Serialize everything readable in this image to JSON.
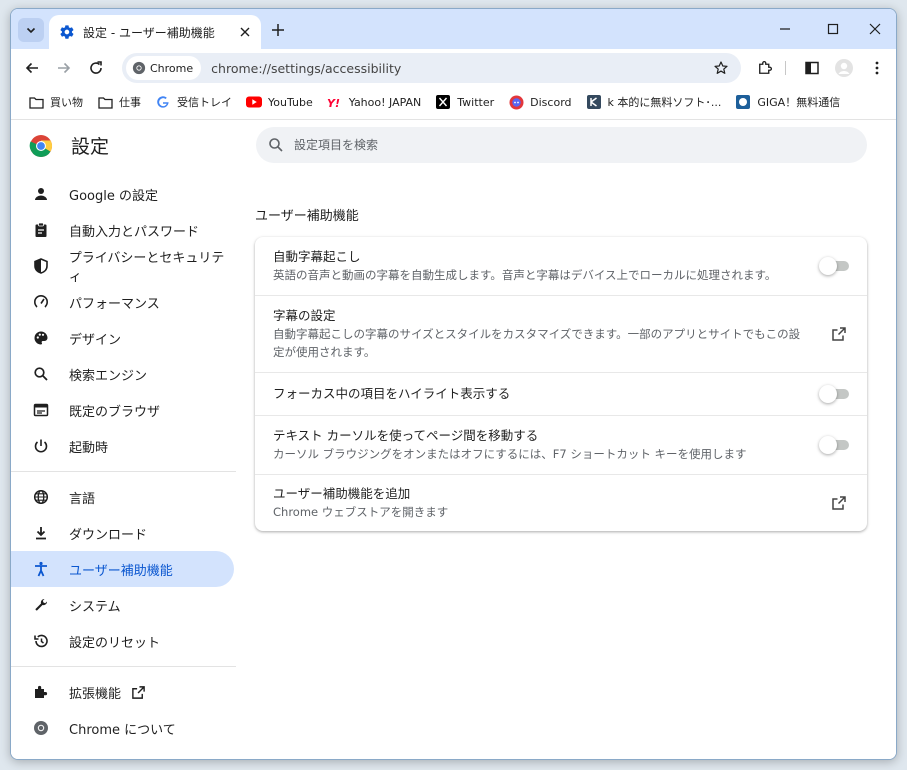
{
  "tab": {
    "title": "設定 - ユーザー補助機能"
  },
  "toolbar": {
    "chip_label": "Chrome",
    "url": "chrome://settings/accessibility"
  },
  "bookmarks": [
    {
      "label": "買い物",
      "icon": "folder-icon"
    },
    {
      "label": "仕事",
      "icon": "folder-icon"
    },
    {
      "label": "受信トレイ",
      "icon": "google-icon"
    },
    {
      "label": "YouTube",
      "icon": "youtube-icon"
    },
    {
      "label": "Yahoo! JAPAN",
      "icon": "yahoo-icon"
    },
    {
      "label": "Twitter",
      "icon": "x-icon"
    },
    {
      "label": "Discord",
      "icon": "discord-icon"
    },
    {
      "label": "k 本的に無料ソフト･...",
      "icon": "site-icon"
    },
    {
      "label": "GIGA！無料通信",
      "icon": "giga-icon"
    }
  ],
  "settings": {
    "title": "設定",
    "search_placeholder": "設定項目を検索",
    "nav": [
      {
        "label": "Google の設定",
        "icon": "person-icon"
      },
      {
        "label": "自動入力とパスワード",
        "icon": "clipboard-icon"
      },
      {
        "label": "プライバシーとセキュリティ",
        "icon": "shield-icon"
      },
      {
        "label": "パフォーマンス",
        "icon": "gauge-icon"
      },
      {
        "label": "デザイン",
        "icon": "palette-icon"
      },
      {
        "label": "検索エンジン",
        "icon": "search-icon"
      },
      {
        "label": "既定のブラウザ",
        "icon": "browser-icon"
      },
      {
        "label": "起動時",
        "icon": "power-icon"
      },
      {
        "label": "言語",
        "icon": "globe-icon"
      },
      {
        "label": "ダウンロード",
        "icon": "download-icon"
      },
      {
        "label": "ユーザー補助機能",
        "icon": "accessibility-icon"
      },
      {
        "label": "システム",
        "icon": "wrench-icon"
      },
      {
        "label": "設定のリセット",
        "icon": "reset-icon"
      },
      {
        "label": "拡張機能",
        "icon": "puzzle-icon"
      },
      {
        "label": "Chrome について",
        "icon": "chrome-icon"
      }
    ],
    "section_title": "ユーザー補助機能",
    "rows": [
      {
        "title": "自動字幕起こし",
        "sub": "英語の音声と動画の字幕を自動生成します。音声と字幕はデバイス上でローカルに処理されます。",
        "control": "toggle",
        "on": false
      },
      {
        "title": "字幕の設定",
        "sub": "自動字幕起こしの字幕のサイズとスタイルをカスタマイズできます。一部のアプリとサイトでもこの設定が使用されます。",
        "control": "external"
      },
      {
        "title": "フォーカス中の項目をハイライト表示する",
        "sub": "",
        "control": "toggle",
        "on": false
      },
      {
        "title": "テキスト カーソルを使ってページ間を移動する",
        "sub": "カーソル ブラウジングをオンまたはオフにするには、F7 ショートカット キーを使用します",
        "control": "toggle",
        "on": false
      },
      {
        "title": "ユーザー補助機能を追加",
        "sub": "Chrome ウェブストアを開きます",
        "control": "external"
      }
    ]
  },
  "colors": {
    "accent": "#0b57d0",
    "tabstrip": "#d3e3fd",
    "active_nav": "#d3e3fd"
  }
}
